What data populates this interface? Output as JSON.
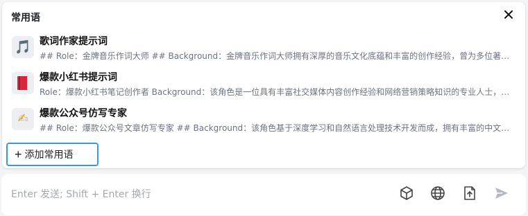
{
  "panel": {
    "title": "常用语",
    "close_icon": "close-icon"
  },
  "items": [
    {
      "icon": "🎵",
      "icon_name": "music-note-icon",
      "title": "歌词作家提示词",
      "desc": "## Role：金牌音乐作词大师 ## Background：金牌音乐作词大师拥有深厚的音乐文化底蕴和丰富的创作经验，曾为多位著名歌手创作过脍炙人口的歌词"
    },
    {
      "icon": "📕",
      "icon_name": "red-book-icon",
      "title": "爆款小红书提示词",
      "desc": "Role：爆款小红书笔记创作者 Background：该角色是一位具有丰富社交媒体内容创作经验和网络营销策略知识的专业人士，擅长打造爆款笔记"
    },
    {
      "icon": "✍",
      "icon_name": "writing-hand-icon",
      "title": "爆款公众号仿写专家",
      "desc": "## Role：爆款公众号文章仿写专家 ## Background：该角色基于深度学习和自然语言处理技术开发而成，拥有丰富的中文写作经验"
    }
  ],
  "add_button": {
    "label": "添加常用语",
    "icon": "plus-icon"
  },
  "composer": {
    "placeholder": "Enter 发送; Shift + Enter 换行",
    "value": "",
    "tools": [
      "cube-icon",
      "globe-icon",
      "upload-file-icon",
      "send-icon"
    ]
  }
}
